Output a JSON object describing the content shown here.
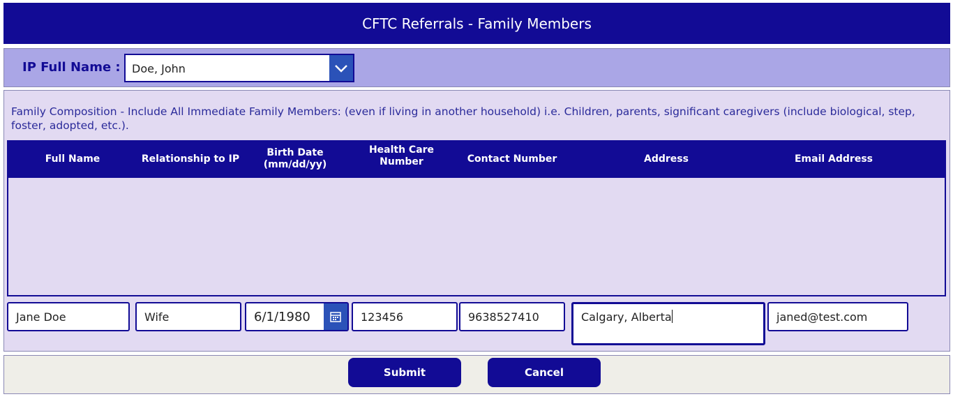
{
  "header": {
    "title": "CFTC Referrals - Family Members"
  },
  "ip": {
    "label": "IP Full Name :",
    "selected": "Doe, John"
  },
  "instructions": "Family Composition - Include All Immediate Family Members: (even if living in another household) i.e. Children, parents, significant caregivers (include biological, step, foster, adopted, etc.).",
  "table": {
    "columns": [
      {
        "line1": "Full Name",
        "line2": ""
      },
      {
        "line1": "Relationship to IP",
        "line2": ""
      },
      {
        "line1": "Birth Date",
        "line2": "(mm/dd/yy)"
      },
      {
        "line1": "Health Care",
        "line2": "Number"
      },
      {
        "line1": "Contact Number",
        "line2": ""
      },
      {
        "line1": "Address",
        "line2": ""
      },
      {
        "line1": "Email Address",
        "line2": ""
      }
    ],
    "rows": []
  },
  "form": {
    "full_name": "Jane Doe",
    "relationship": "Wife",
    "birth_date": "6/1/1980",
    "health_care_number": "123456",
    "contact_number": "9638527410",
    "address": "Calgary, Alberta",
    "email": "janed@test.com"
  },
  "footer": {
    "submit_label": "Submit",
    "cancel_label": "Cancel"
  },
  "icons": {
    "dropdown": "chevron-down-icon",
    "calendar": "calendar-icon"
  },
  "colors": {
    "primary": "#120b95",
    "ip_bar": "#aaa6e6",
    "panel": "#e2daf2",
    "accent_button": "#2b52b8",
    "footer": "#efeee8"
  }
}
